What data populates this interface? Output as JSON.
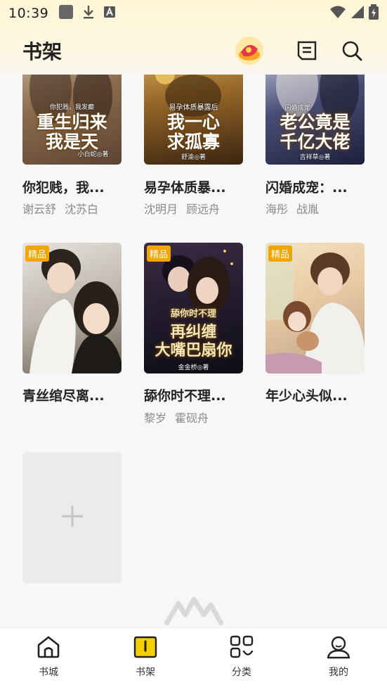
{
  "status_bar": {
    "time": "10:39"
  },
  "header": {
    "title": "书架"
  },
  "books": [
    {
      "title": "你犯贱，我...",
      "authors": [
        "谢云舒",
        "沈苏白"
      ],
      "cover_title": [
        "重生归来",
        "我是天"
      ],
      "cover_sub": "你犯贱，我发癫",
      "cover_author": "小白蛇◎著",
      "badge": ""
    },
    {
      "title": "易孕体质暴...",
      "authors": [
        "沈明月",
        "顾远舟"
      ],
      "cover_title": [
        "我一心",
        "求孤寡"
      ],
      "cover_sub": "易孕体质暴露后",
      "cover_author": "舒渝◎著",
      "badge": ""
    },
    {
      "title": "闪婚成宠：...",
      "authors": [
        "海彤",
        "战胤"
      ],
      "cover_title": [
        "老公竟是",
        "千亿大佬"
      ],
      "cover_sub": "闪婚成宠",
      "cover_author": "吉祥草◎著",
      "badge": ""
    },
    {
      "title": "青丝绾尽离...",
      "authors": [],
      "cover_title": [],
      "cover_sub": "",
      "cover_author": "",
      "badge": "精品"
    },
    {
      "title": "舔你时不理...",
      "authors": [
        "黎岁",
        "霍砚舟"
      ],
      "cover_title": [
        "舔你时不理",
        "再纠缠",
        "大嘴巴扇你"
      ],
      "cover_sub": "",
      "cover_author": "金金桥◎著",
      "badge": "精品"
    },
    {
      "title": "年少心头似...",
      "authors": [],
      "cover_title": [],
      "cover_sub": "",
      "cover_author": "",
      "badge": "精品"
    }
  ],
  "tabs": [
    {
      "label": "书城",
      "icon": "home-icon",
      "active": false
    },
    {
      "label": "书架",
      "icon": "bookshelf-icon",
      "active": true
    },
    {
      "label": "分类",
      "icon": "category-icon",
      "active": false
    },
    {
      "label": "我的",
      "icon": "profile-icon",
      "active": false
    }
  ],
  "colors": {
    "accent": "#f5d000",
    "badge": "#f0a500",
    "header_bg": "#fff6d6"
  }
}
